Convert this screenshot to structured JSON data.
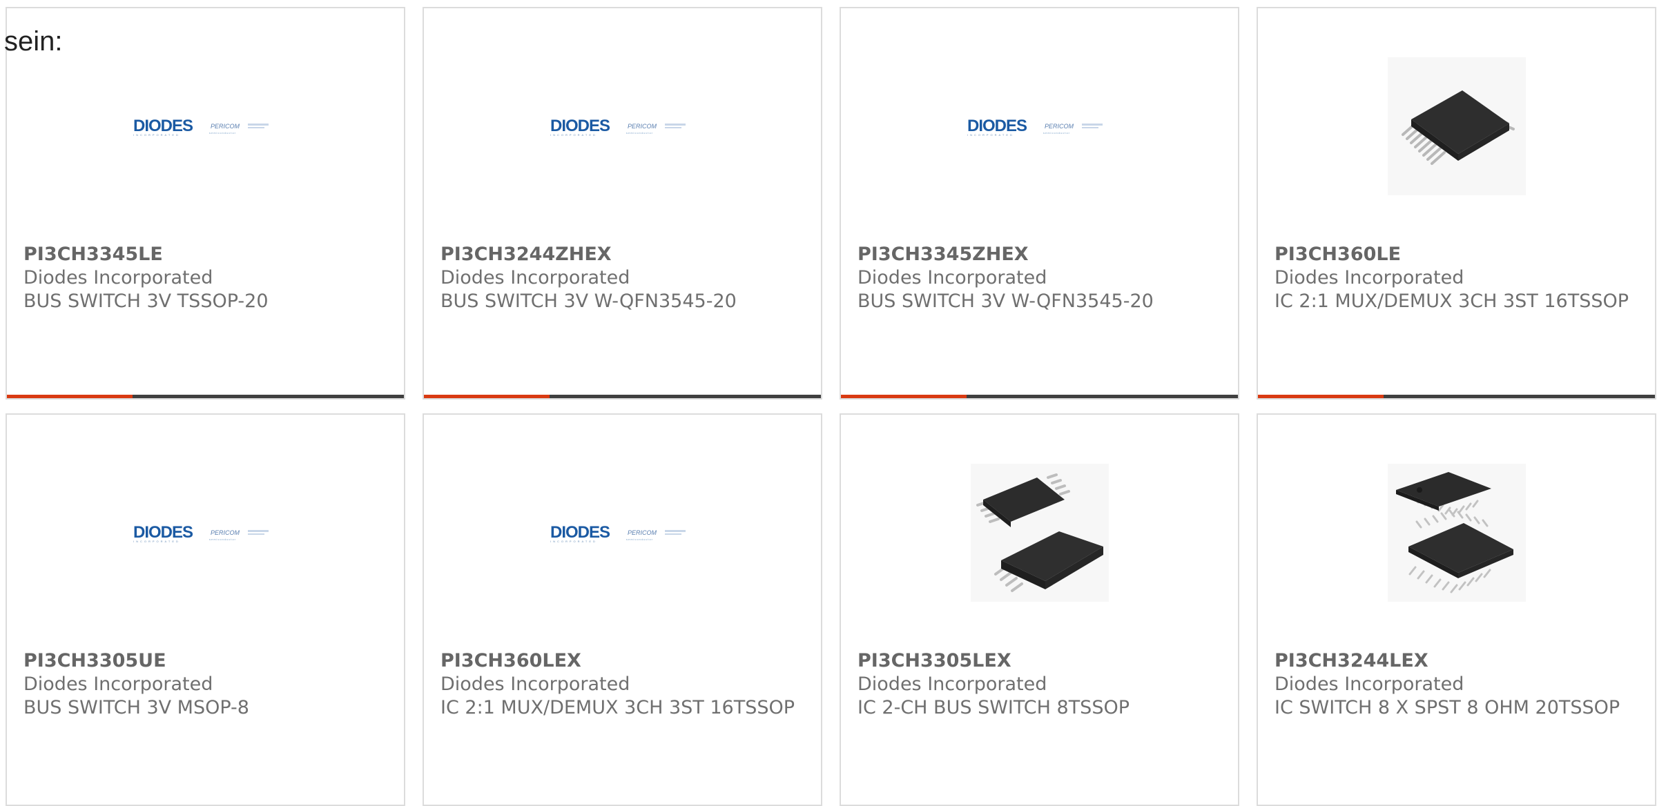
{
  "intro_text": "sein:",
  "accent_color": "#d93a12",
  "logo": {
    "brand": "DIODES",
    "brand_sub": "INCORPORATED",
    "partner": "PERICOM",
    "partner_sub": "semiconductor"
  },
  "products": [
    {
      "part": "PI3CH3345LE",
      "manufacturer": "Diodes Incorporated",
      "description": "BUS SWITCH 3V TSSOP-20",
      "image": "diodes-pericom-logo"
    },
    {
      "part": "PI3CH3244ZHEX",
      "manufacturer": "Diodes Incorporated",
      "description": "BUS SWITCH 3V W-QFN3545-20",
      "image": "diodes-pericom-logo"
    },
    {
      "part": "PI3CH3345ZHEX",
      "manufacturer": "Diodes Incorporated",
      "description": "BUS SWITCH 3V W-QFN3545-20",
      "image": "diodes-pericom-logo"
    },
    {
      "part": "PI3CH360LE",
      "manufacturer": "Diodes Incorporated",
      "description": "IC 2:1 MUX/DEMUX 3CH 3ST 16TSSOP",
      "image": "tssop-chip-photo"
    },
    {
      "part": "PI3CH3305UE",
      "manufacturer": "Diodes Incorporated",
      "description": "BUS SWITCH 3V MSOP-8",
      "image": "diodes-pericom-logo"
    },
    {
      "part": "PI3CH360LEX",
      "manufacturer": "Diodes Incorporated",
      "description": "IC 2:1 MUX/DEMUX 3CH 3ST 16TSSOP",
      "image": "diodes-pericom-logo"
    },
    {
      "part": "PI3CH3305LEX",
      "manufacturer": "Diodes Incorporated",
      "description": "IC 2-CH BUS SWITCH 8TSSOP",
      "image": "tssop8-pair-photo"
    },
    {
      "part": "PI3CH3244LEX",
      "manufacturer": "Diodes Incorporated",
      "description": "IC SWITCH 8 X SPST 8 OHM 20TSSOP",
      "image": "tssop20-pair-photo"
    }
  ]
}
